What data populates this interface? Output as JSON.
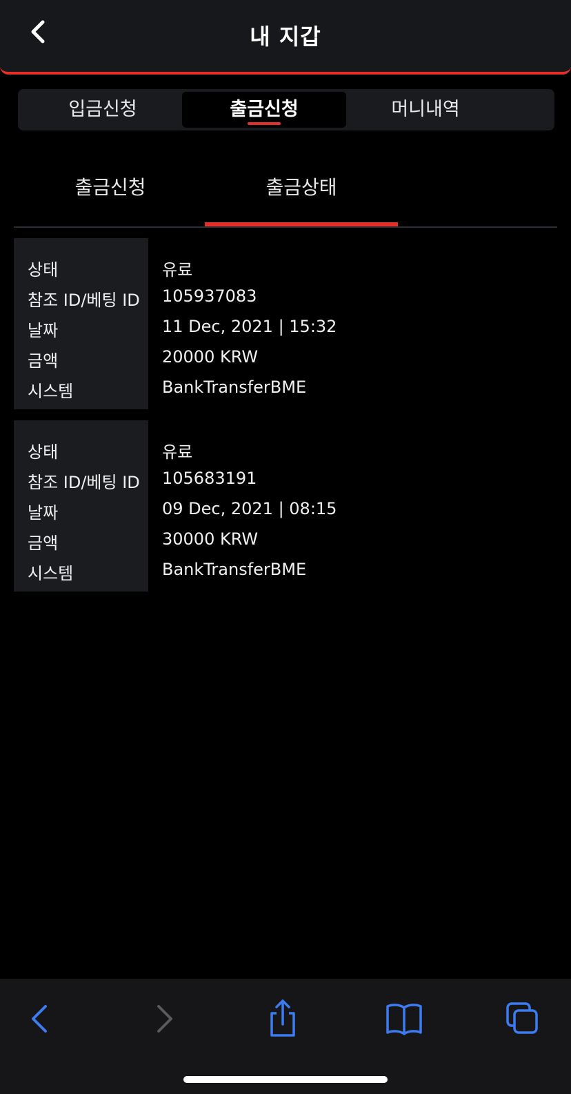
{
  "header": {
    "title": "내 지갑",
    "back_icon": "chevron-left-icon"
  },
  "segments": {
    "items": [
      {
        "label": "입금신청",
        "active": false
      },
      {
        "label": "출금신청",
        "active": true
      },
      {
        "label": "머니내역",
        "active": false
      }
    ]
  },
  "subtabs": {
    "items": [
      {
        "label": "출금신청",
        "active": false
      },
      {
        "label": "출금상태",
        "active": true
      }
    ]
  },
  "records": [
    {
      "status_label": "상태",
      "status": "유료",
      "ref_label": "참조 ID/베팅 ID",
      "ref": "105937083",
      "date_label": "날짜",
      "date": "11 Dec, 2021 | 15:32",
      "amount_label": "금액",
      "amount": "20000 KRW",
      "system_label": "시스템",
      "system": "BankTransferBME"
    },
    {
      "status_label": "상태",
      "status": "유료",
      "ref_label": "참조 ID/베팅 ID",
      "ref": "105683191",
      "date_label": "날짜",
      "date": "09 Dec, 2021 | 08:15",
      "amount_label": "금액",
      "amount": "30000 KRW",
      "system_label": "시스템",
      "system": "BankTransferBME"
    }
  ],
  "browser_toolbar": {
    "icons": [
      "back-icon",
      "forward-icon",
      "share-icon",
      "bookmarks-icon",
      "tabs-icon"
    ]
  },
  "colors": {
    "accent": "#e3312a",
    "toolbar_icon": "#3d7bf0",
    "toolbar_icon_disabled": "#5a5a5e"
  }
}
